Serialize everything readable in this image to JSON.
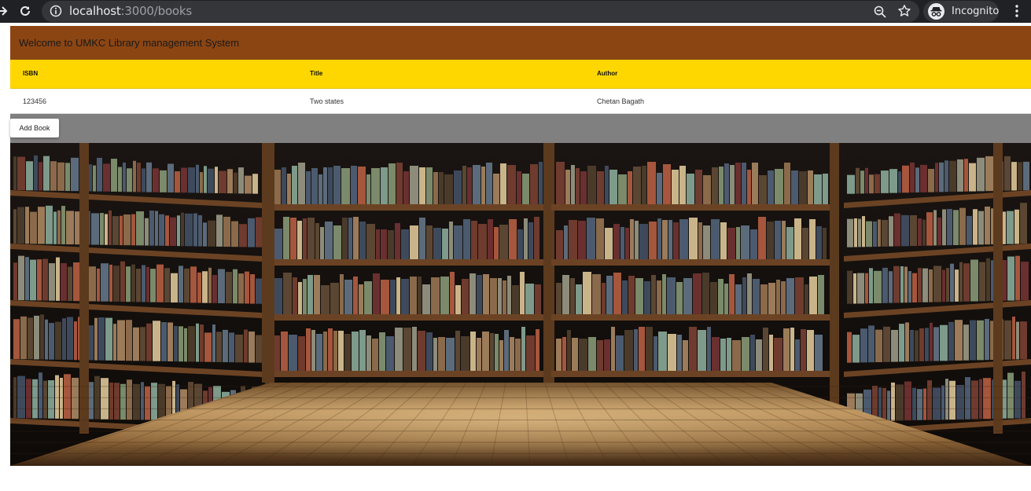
{
  "browser": {
    "url_host": "localhost",
    "url_rest": ":3000/books",
    "profile_label": "Incognito",
    "icons": [
      "forward-icon",
      "reload-icon",
      "site-info-icon",
      "zoom-icon",
      "bookmark-star-icon",
      "incognito-icon",
      "menu-icon"
    ]
  },
  "header": {
    "title": "Welcome to UMKC Library management System",
    "color": "#8b4513"
  },
  "table": {
    "header_color": "#ffd700",
    "columns": [
      "ISBN",
      "Title",
      "Author"
    ],
    "rows": [
      {
        "isbn": "123456",
        "title": "Two states",
        "author": "Chetan Bagath"
      }
    ]
  },
  "actions": {
    "add_book_label": "Add Book"
  },
  "background_image": "bookshelf-library-room"
}
